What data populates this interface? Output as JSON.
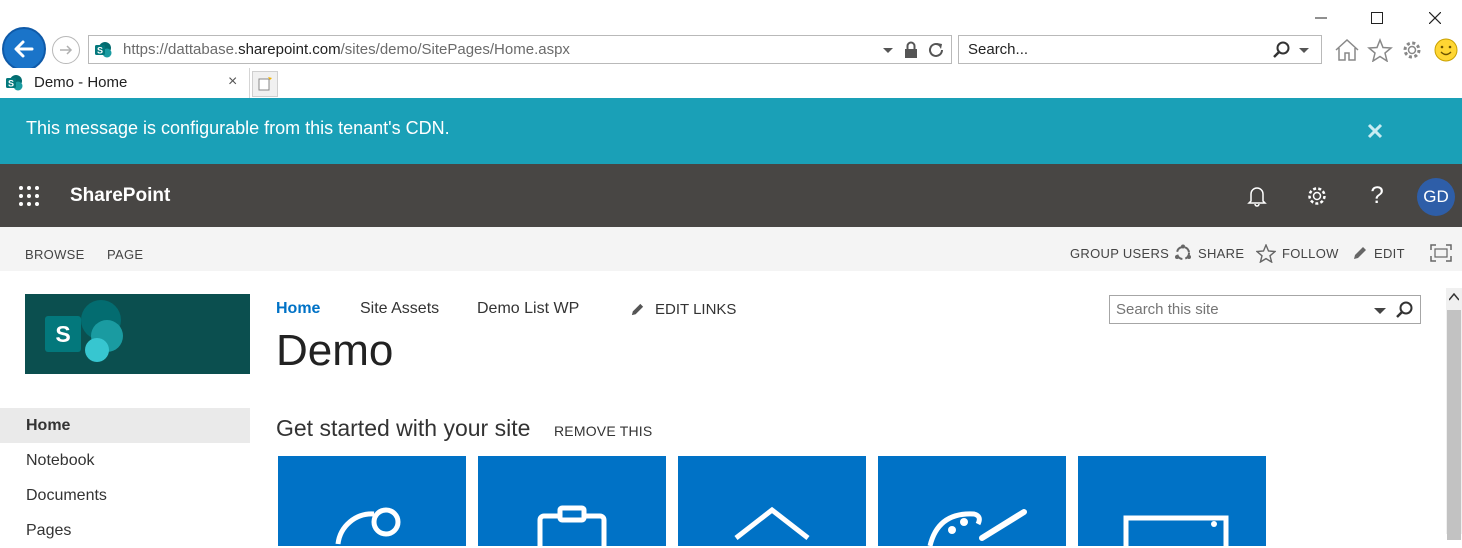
{
  "browser": {
    "url_prefix": "https://dattabase.",
    "url_domain": "sharepoint.com",
    "url_path": "/sites/demo/SitePages/Home.aspx",
    "search_text": "Search...",
    "tab_title": "Demo - Home",
    "tab_close": "×"
  },
  "message_bar": {
    "text": "This message is configurable from this tenant's CDN.",
    "color": "#1aa0b7"
  },
  "suite_bar": {
    "brand": "SharePoint",
    "avatar_initials": "GD",
    "help_glyph": "?",
    "color": "#484644"
  },
  "ribbon": {
    "tabs": [
      "BROWSE",
      "PAGE"
    ],
    "actions": {
      "group_users": "GROUP USERS",
      "share": "SHARE",
      "follow": "FOLLOW",
      "edit": "EDIT"
    }
  },
  "top_nav": {
    "items": [
      "Home",
      "Site Assets",
      "Demo List WP"
    ],
    "edit_links": "EDIT LINKS"
  },
  "site": {
    "title": "Demo",
    "search_placeholder": "Search this site"
  },
  "left_nav": {
    "items": [
      "Home",
      "Notebook",
      "Documents",
      "Pages"
    ]
  },
  "get_started": {
    "heading": "Get started with your site",
    "remove_label": "REMOVE THIS",
    "tile_color": "#0072c6"
  }
}
